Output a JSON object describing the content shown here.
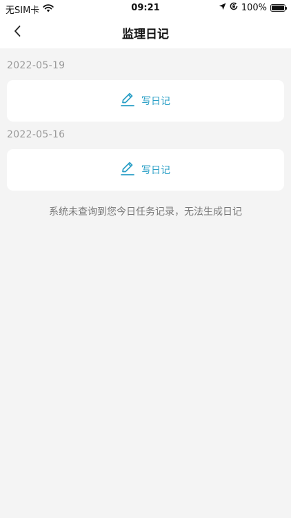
{
  "status_bar": {
    "carrier": "无SIM卡",
    "time": "09:21",
    "battery_percent": "100%",
    "battery_level": 1.0
  },
  "nav": {
    "title": "监理日记"
  },
  "diary_entries": [
    {
      "date": "2022-05-19",
      "action_label": "写日记"
    },
    {
      "date": "2022-05-16",
      "action_label": "写日记"
    }
  ],
  "notice": "系统未查询到您今日任务记录，无法生成日记",
  "colors": {
    "accent": "#2a9fc6",
    "background": "#f4f4f4",
    "card": "#ffffff",
    "muted_text": "#9a9a9a"
  },
  "icons": {
    "back": "chevron-left-icon",
    "write": "pencil-edit-icon",
    "wifi": "wifi-icon",
    "location": "location-arrow-icon",
    "rotation_lock": "rotation-lock-icon",
    "battery": "battery-icon"
  }
}
